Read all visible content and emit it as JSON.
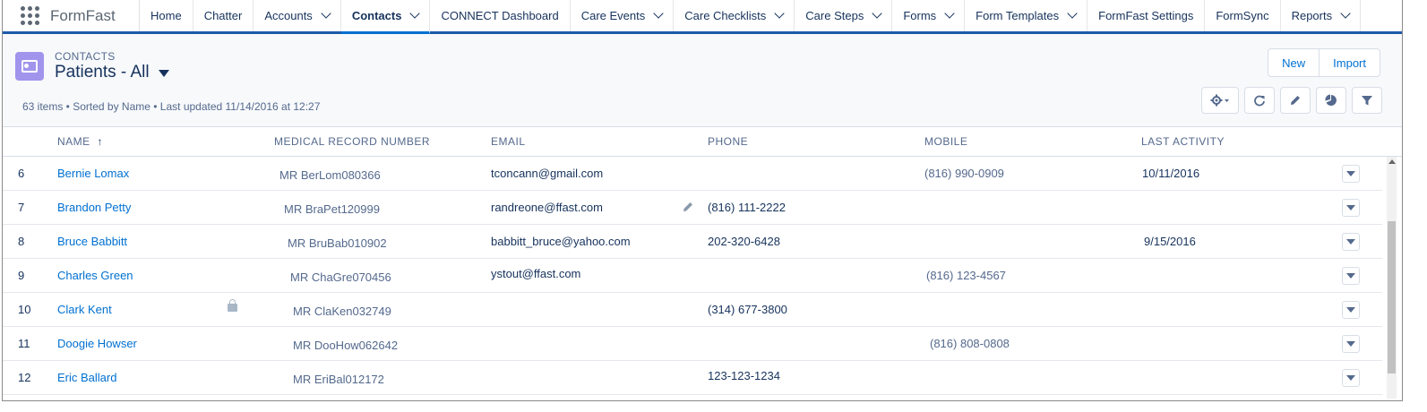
{
  "app": {
    "name": "FormFast"
  },
  "nav": {
    "tabs": [
      {
        "label": "Home"
      },
      {
        "label": "Chatter"
      },
      {
        "label": "Accounts",
        "has_menu": true
      },
      {
        "label": "Contacts",
        "has_menu": true,
        "active": true
      },
      {
        "label": "CONNECT Dashboard"
      },
      {
        "label": "Care Events",
        "has_menu": true
      },
      {
        "label": "Care Checklists",
        "has_menu": true
      },
      {
        "label": "Care Steps",
        "has_menu": true
      },
      {
        "label": "Forms",
        "has_menu": true
      },
      {
        "label": "Form Templates",
        "has_menu": true
      },
      {
        "label": "FormFast Settings"
      },
      {
        "label": "FormSync"
      },
      {
        "label": "Reports",
        "has_menu": true
      }
    ]
  },
  "header": {
    "object_label": "CONTACTS",
    "list_view": "Patients - All",
    "meta": "63 items • Sorted by Name • Last updated 11/14/2016 at 12:27",
    "buttons": {
      "new": "New",
      "import": "Import"
    },
    "tool_icons": [
      "gear-icon",
      "refresh-icon",
      "edit-icon",
      "pie-chart-icon",
      "filter-icon"
    ]
  },
  "table": {
    "columns": {
      "name": "NAME",
      "mrn": "MEDICAL RECORD NUMBER",
      "email": "EMAIL",
      "phone": "PHONE",
      "mobile": "MOBILE",
      "last_activity": "LAST ACTIVITY"
    },
    "sort_indicator": "↑",
    "rows": [
      {
        "num": "6",
        "name": "Bernie Lomax",
        "mrn": "MR BerLom080366",
        "email": "tconcann@gmail.com",
        "phone": "",
        "mobile": "(816) 990-0909",
        "last": "10/11/2016"
      },
      {
        "num": "7",
        "name": "Brandon Petty",
        "mrn": "MR BraPet120999",
        "email": "randreone@ffast.com",
        "phone": "(816) 111-2222",
        "mobile": "",
        "last": ""
      },
      {
        "num": "8",
        "name": "Bruce Babbitt",
        "mrn": "MR BruBab010902",
        "email": "babbitt_bruce@yahoo.com",
        "phone": "202-320-6428",
        "mobile": "",
        "last": "9/15/2016"
      },
      {
        "num": "9",
        "name": "Charles Green",
        "mrn": "MR ChaGre070456",
        "email": "ystout@ffast.com",
        "phone": "",
        "mobile": "(816) 123-4567",
        "last": ""
      },
      {
        "num": "10",
        "name": "Clark Kent",
        "mrn": "MR ClaKen032749",
        "email": "",
        "phone": "(314) 677-3800",
        "mobile": "",
        "last": "",
        "locked": true
      },
      {
        "num": "11",
        "name": "Doogie Howser",
        "mrn": "MR DooHow062642",
        "email": "",
        "phone": "",
        "mobile": "(816) 808-0808",
        "last": ""
      },
      {
        "num": "12",
        "name": "Eric Ballard",
        "mrn": "MR EriBal012172",
        "email": "",
        "phone": "123-123-1234",
        "mobile": "",
        "last": ""
      }
    ]
  }
}
